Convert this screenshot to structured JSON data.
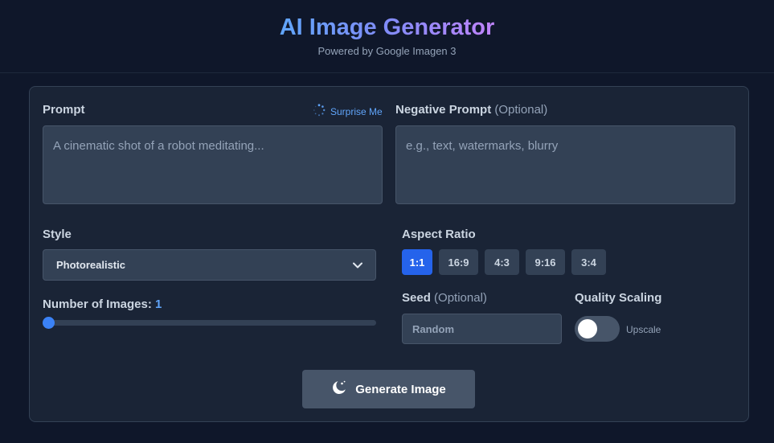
{
  "header": {
    "title": "AI Image Generator",
    "subtitle": "Powered by Google Imagen 3"
  },
  "prompt": {
    "label": "Prompt",
    "surprise_label": "Surprise Me",
    "placeholder": "A cinematic shot of a robot meditating..."
  },
  "negative_prompt": {
    "label": "Negative Prompt",
    "optional": "(Optional)",
    "placeholder": "e.g., text, watermarks, blurry"
  },
  "style": {
    "label": "Style",
    "selected": "Photorealistic"
  },
  "aspect_ratio": {
    "label": "Aspect Ratio",
    "options": [
      "1:1",
      "16:9",
      "4:3",
      "9:16",
      "3:4"
    ],
    "selected": "1:1"
  },
  "num_images": {
    "label": "Number of Images:",
    "value": "1",
    "min": 1,
    "max": 4
  },
  "seed": {
    "label": "Seed",
    "optional": "(Optional)",
    "placeholder": "Random"
  },
  "quality": {
    "label": "Quality Scaling",
    "toggle_label": "Upscale",
    "enabled": false
  },
  "generate": {
    "label": "Generate Image"
  },
  "colors": {
    "background": "#0f172a",
    "accent": "#3b82f6",
    "active_ratio": "#2563eb"
  }
}
